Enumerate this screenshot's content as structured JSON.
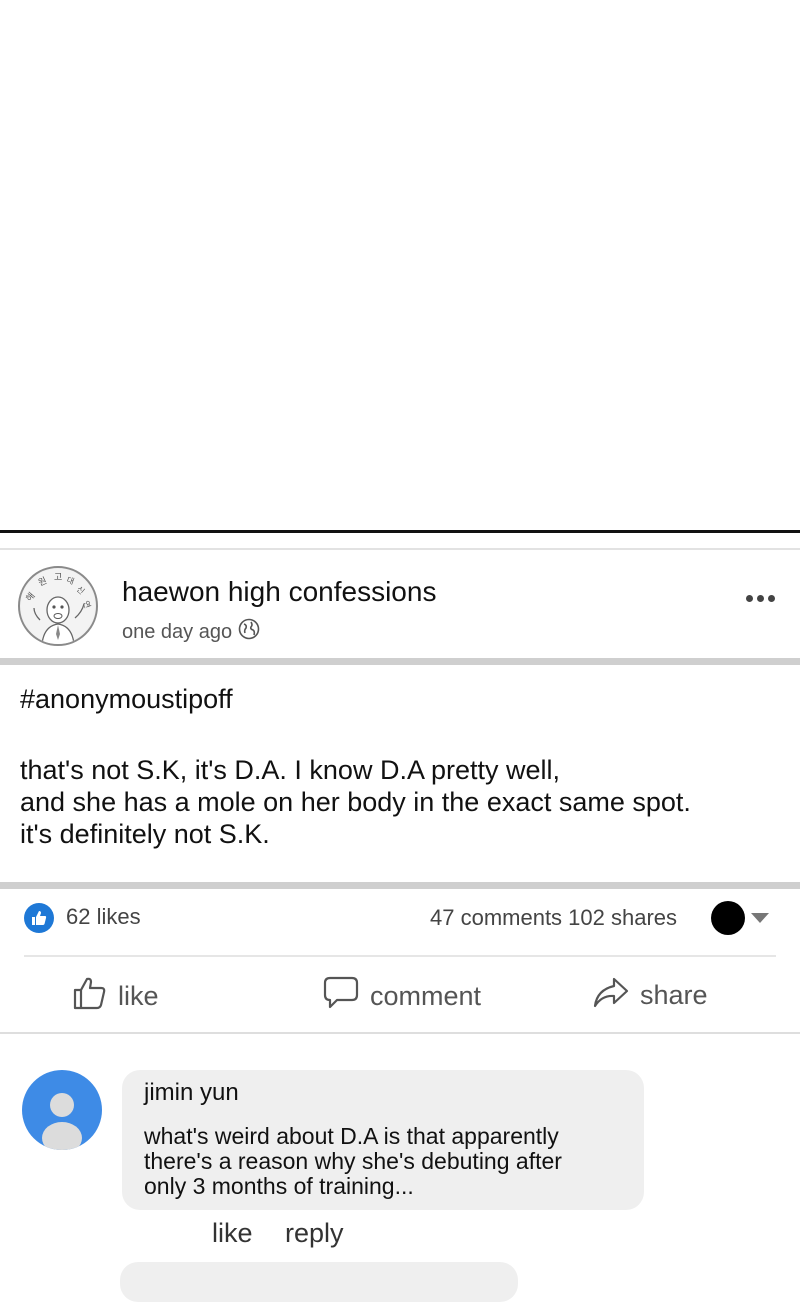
{
  "post": {
    "page_name": "haewon high confessions",
    "time": "one day ago",
    "hashtag": "#anonymoustipoff",
    "body_lines": [
      "that's not S.K, it's D.A. I know D.A pretty well,",
      "and she has a mole on her body in the exact same spot.",
      "it's definitely not S.K."
    ],
    "stats": {
      "likes": "62 likes",
      "comments_shares": "47 comments 102 shares"
    },
    "actions": {
      "like": "like",
      "comment": "comment",
      "share": "share"
    }
  },
  "comments": [
    {
      "author": "jimin yun",
      "lines": [
        "what's weird about D.A is that apparently",
        "there's a reason why she's debuting after",
        "only 3 months of training..."
      ],
      "like_label": "like",
      "reply_label": "reply"
    }
  ],
  "colors": {
    "like_badge": "#1e78d6",
    "user_avatar": "#3e8be6",
    "bubble": "#efefef",
    "separator": "#cfcfcf"
  },
  "icons": [
    "globe-icon",
    "more-options-icon",
    "thumbs-up-icon",
    "comment-icon",
    "share-arrow-icon",
    "dropdown-caret-icon"
  ]
}
